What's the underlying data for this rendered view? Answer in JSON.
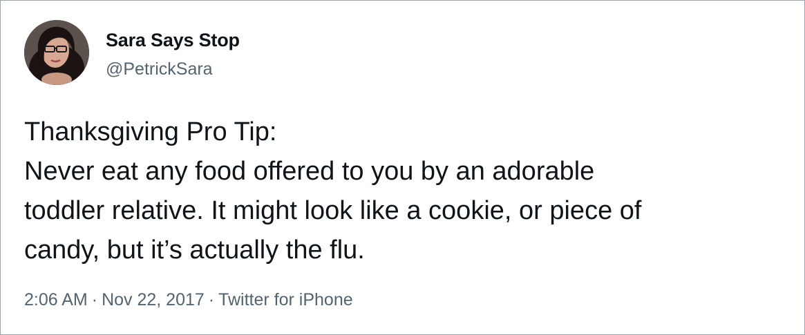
{
  "author": {
    "name": "Sara Says Stop",
    "handle": "@PetrickSara"
  },
  "tweet": {
    "lines": [
      "Thanksgiving Pro Tip:",
      "Never eat any food offered to you by an adorable",
      "toddler relative. It might look like a cookie, or piece of",
      "candy, but it’s actually the flu."
    ]
  },
  "meta": {
    "time": "2:06 AM",
    "date": "Nov 22, 2017",
    "source": "Twitter for iPhone",
    "separator": "·"
  },
  "colors": {
    "text": "#0f1419",
    "secondary": "#536471",
    "border": "#9aa3ab"
  }
}
